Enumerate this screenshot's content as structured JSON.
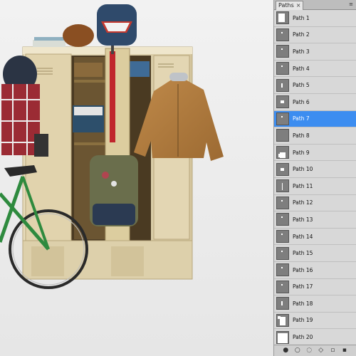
{
  "panel": {
    "tab_label": "Paths",
    "close_glyph": "×",
    "menu_glyph": "≡",
    "selected_index": 6,
    "accent_color": "#3c8df0",
    "paths": [
      {
        "label": "Path 1",
        "thumb": "top-bag-shape"
      },
      {
        "label": "Path 2",
        "thumb": "small-mark"
      },
      {
        "label": "Path 3",
        "thumb": "small-mark"
      },
      {
        "label": "Path 4",
        "thumb": "small-mark"
      },
      {
        "label": "Path 5",
        "thumb": "tall-mark"
      },
      {
        "label": "Path 6",
        "thumb": "dot-mark"
      },
      {
        "label": "Path 7",
        "thumb": "small-mark"
      },
      {
        "label": "Path 8",
        "thumb": "empty"
      },
      {
        "label": "Path 9",
        "thumb": "blob-mark"
      },
      {
        "label": "Path 10",
        "thumb": "dot-mark"
      },
      {
        "label": "Path 11",
        "thumb": "line-mark"
      },
      {
        "label": "Path 12",
        "thumb": "small-mark"
      },
      {
        "label": "Path 13",
        "thumb": "small-mark"
      },
      {
        "label": "Path 14",
        "thumb": "small-mark"
      },
      {
        "label": "Path 15",
        "thumb": "small-mark"
      },
      {
        "label": "Path 16",
        "thumb": "small-mark"
      },
      {
        "label": "Path 17",
        "thumb": "small-mark"
      },
      {
        "label": "Path 18",
        "thumb": "tall-mark"
      },
      {
        "label": "Path 19",
        "thumb": "figure-shape"
      },
      {
        "label": "Path 20",
        "thumb": "large-shape"
      }
    ],
    "bottom_icons": [
      "fill-path-icon",
      "stroke-path-icon",
      "load-selection-icon",
      "make-work-path-icon",
      "new-path-icon",
      "delete-path-icon"
    ]
  }
}
